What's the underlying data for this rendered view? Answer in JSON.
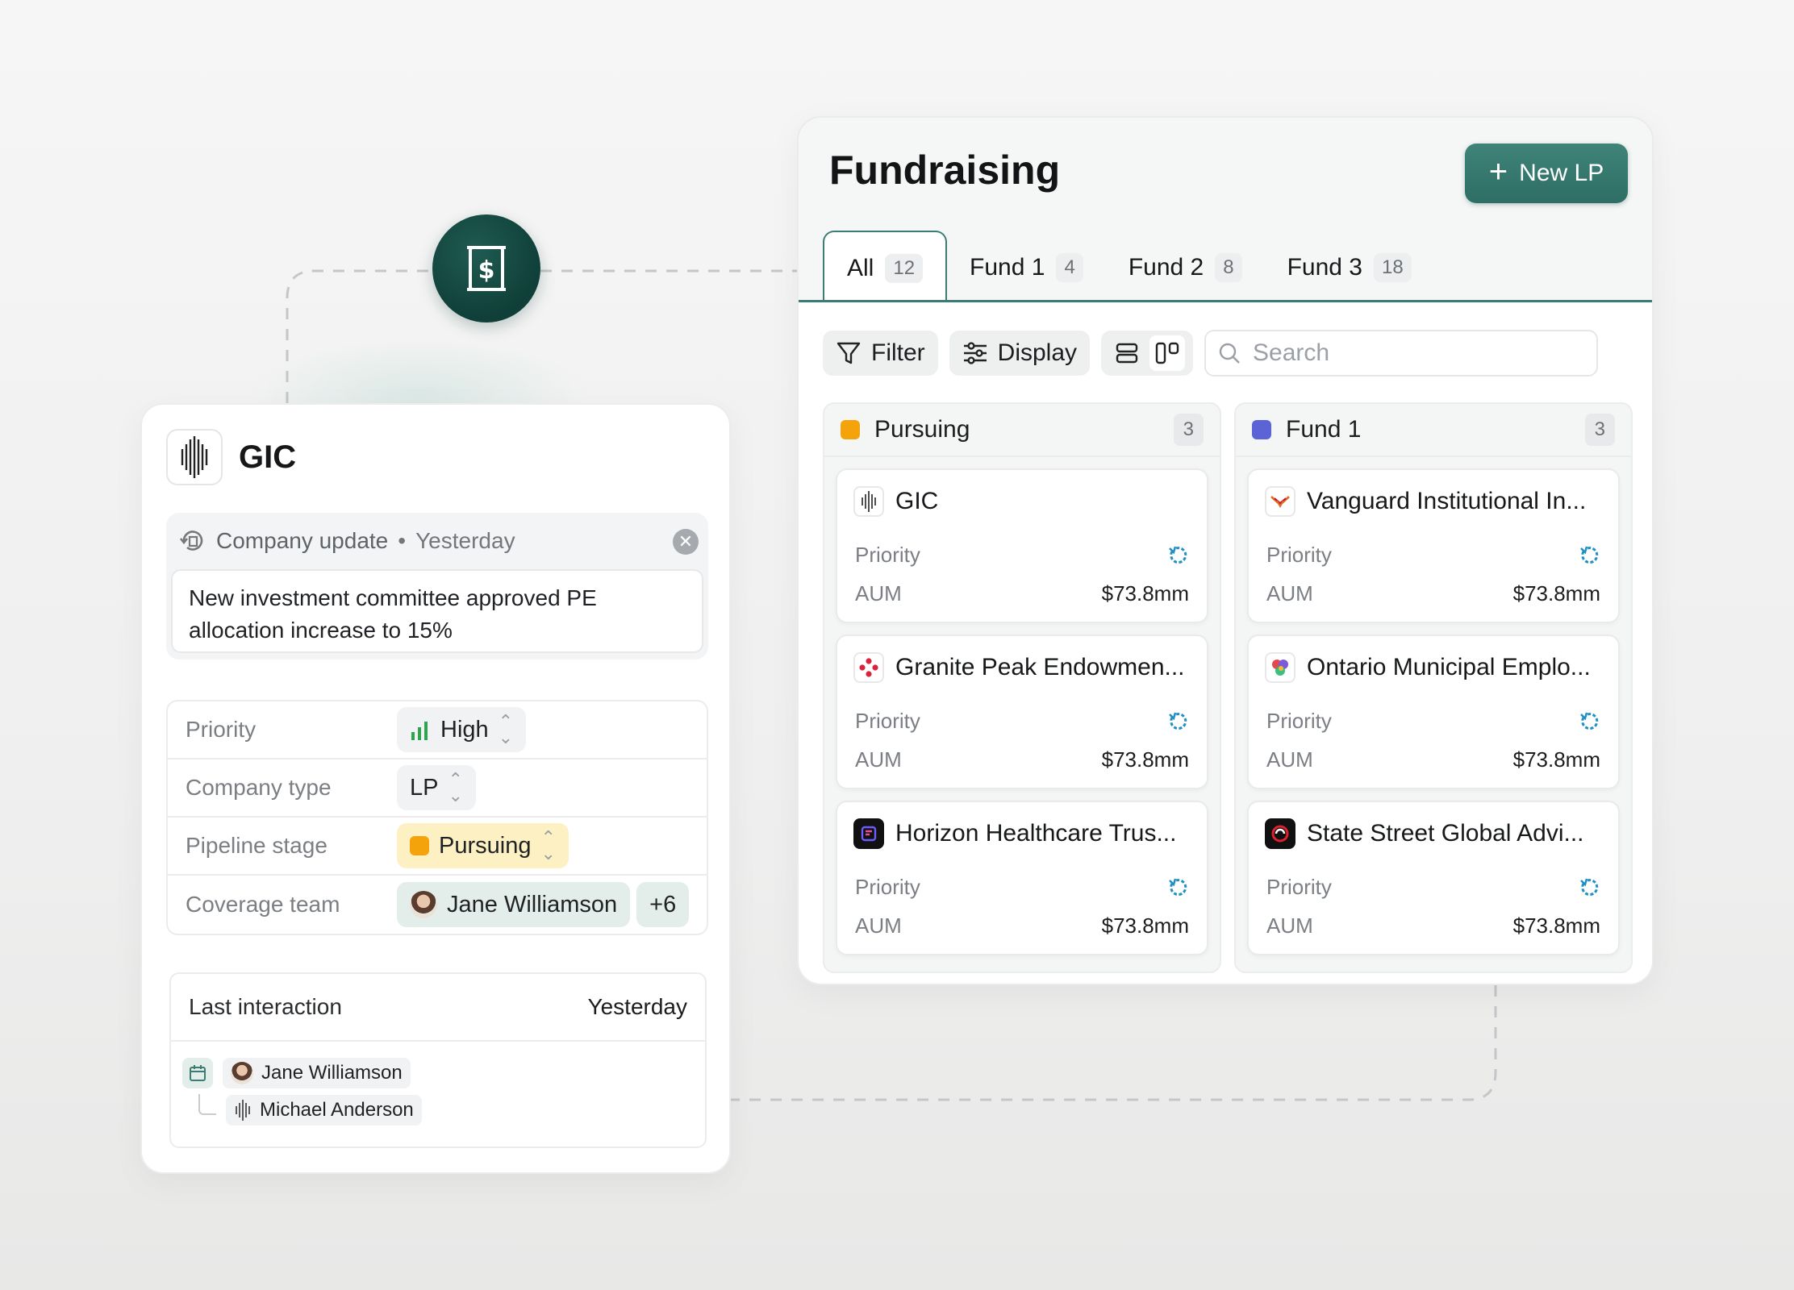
{
  "detail": {
    "title": "GIC",
    "update": {
      "label": "Company update",
      "separator": "•",
      "time": "Yesterday",
      "body": "New investment committee approved PE allocation increase to 15%"
    },
    "properties": [
      {
        "label": "Priority",
        "value": "High"
      },
      {
        "label": "Company type",
        "value": "LP"
      },
      {
        "label": "Pipeline stage",
        "value": "Pursuing"
      },
      {
        "label": "Coverage team",
        "value": "Jane Williamson",
        "extra": "+6"
      }
    ],
    "last_interaction": {
      "label": "Last interaction",
      "value": "Yesterday",
      "people": [
        "Jane Williamson",
        "Michael Anderson"
      ]
    }
  },
  "board": {
    "title": "Fundraising",
    "new_button": "New LP",
    "tabs": [
      {
        "label": "All",
        "count": "12"
      },
      {
        "label": "Fund 1",
        "count": "4"
      },
      {
        "label": "Fund 2",
        "count": "8"
      },
      {
        "label": "Fund 3",
        "count": "18"
      }
    ],
    "toolbar": {
      "filter": "Filter",
      "display": "Display",
      "search_placeholder": "Search"
    },
    "columns": [
      {
        "name": "Pursuing",
        "count": "3",
        "color": "#f5a30a",
        "cards": [
          {
            "name": "GIC",
            "priority_label": "Priority",
            "aum_label": "AUM",
            "aum": "$73.8mm",
            "logo": "gic-logo-icon"
          },
          {
            "name": "Granite Peak Endowmen...",
            "priority_label": "Priority",
            "aum_label": "AUM",
            "aum": "$73.8mm",
            "logo": "red-dots-logo-icon"
          },
          {
            "name": "Horizon Healthcare Trus...",
            "priority_label": "Priority",
            "aum_label": "AUM",
            "aum": "$73.8mm",
            "logo": "horizon-logo-icon"
          }
        ]
      },
      {
        "name": "Fund 1",
        "count": "3",
        "color": "#5b63d6",
        "cards": [
          {
            "name": "Vanguard Institutional In...",
            "priority_label": "Priority",
            "aum_label": "AUM",
            "aum": "$73.8mm",
            "logo": "vanguard-logo-icon"
          },
          {
            "name": "Ontario Municipal Emplo...",
            "priority_label": "Priority",
            "aum_label": "AUM",
            "aum": "$73.8mm",
            "logo": "ontario-logo-icon"
          },
          {
            "name": "State Street Global Advi...",
            "priority_label": "Priority",
            "aum_label": "AUM",
            "aum": "$73.8mm",
            "logo": "state-street-logo-icon"
          }
        ]
      }
    ]
  },
  "colors": {
    "accent": "#2e6e64",
    "hub": "#0f3f38",
    "pursuing": "#f5a30a",
    "fund1": "#5b63d6",
    "priority_icon": "#1f8fc4",
    "high_bars": "#2ea44f"
  }
}
